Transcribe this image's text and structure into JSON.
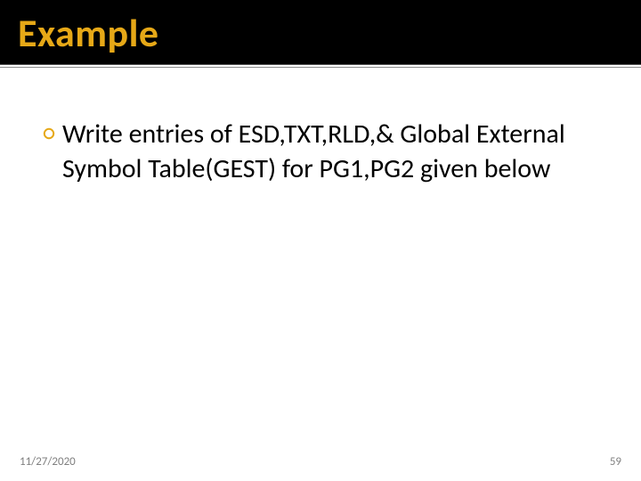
{
  "title": "Example",
  "bullets": [
    {
      "text": "Write entries of ESD,TXT,RLD,& Global External Symbol Table(GEST) for PG1,PG2 given below"
    }
  ],
  "footer": {
    "date": "11/27/2020",
    "page": "59"
  }
}
